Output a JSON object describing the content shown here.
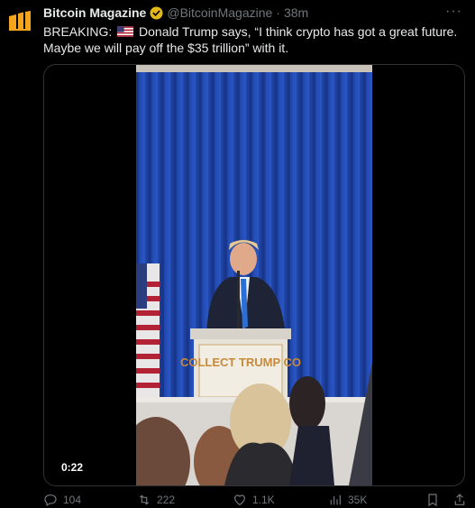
{
  "tweet": {
    "author_name": "Bitcoin Magazine",
    "handle": "@BitcoinMagazine",
    "separator": "·",
    "time": "38m",
    "more_label": "···",
    "text_prefix": "BREAKING:",
    "text_main": "Donald Trump says, “I think crypto has got a great future. Maybe we will pay off the $35 trillion” with it.",
    "flag_icon": "us-flag-icon",
    "verified_color": "#e2b719"
  },
  "media": {
    "duration": "0:22",
    "podium_text": "COLLECT TRUMP CO",
    "curtain_color": "#1f45a8"
  },
  "actions": {
    "replies": "104",
    "reposts": "222",
    "likes": "1.1K",
    "views": "35K"
  }
}
